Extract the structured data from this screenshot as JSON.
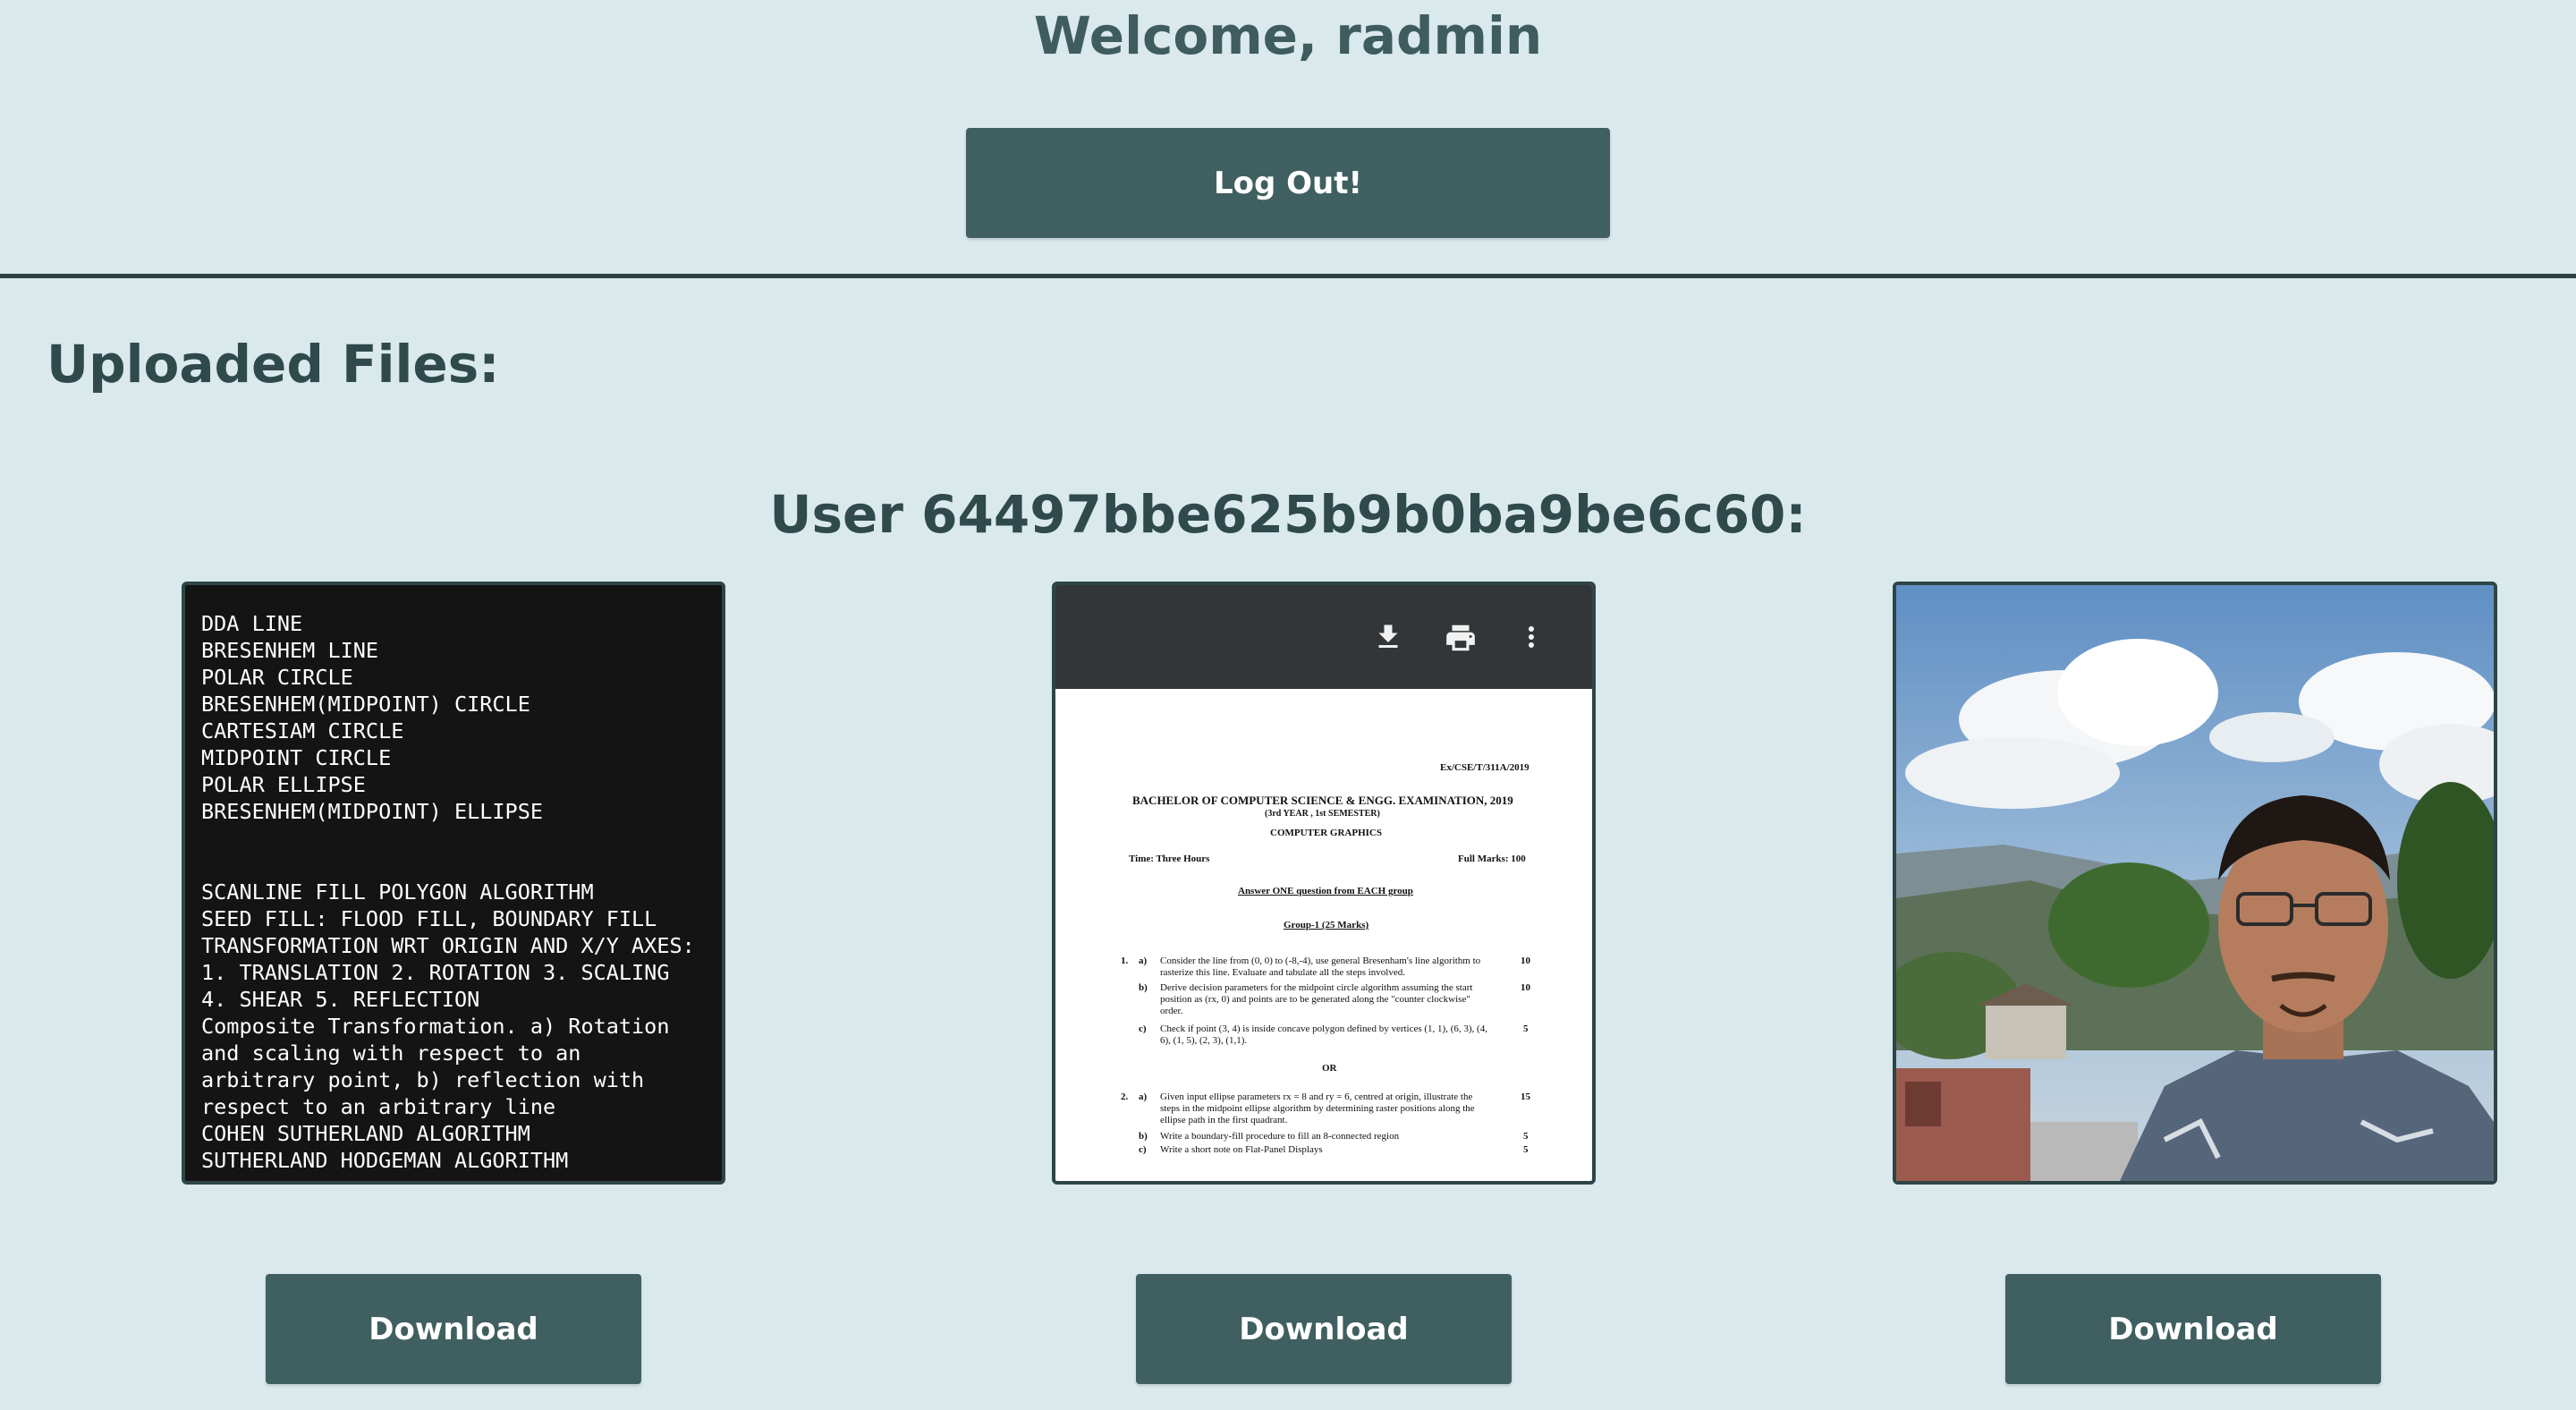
{
  "header": {
    "welcome": "Welcome, radmin",
    "logout_label": "Log Out!"
  },
  "section": {
    "uploaded_title": "Uploaded Files:",
    "user_title": "User 64497bbe625b9b0ba9be6c60:"
  },
  "files": [
    {
      "type": "text",
      "content": "DDA LINE\nBRESENHEM LINE\nPOLAR CIRCLE\nBRESENHEM(MIDPOINT) CIRCLE\nCARTESIAM CIRCLE\nMIDPOINT CIRCLE\nPOLAR ELLIPSE\nBRESENHEM(MIDPOINT) ELLIPSE\n\n\nSCANLINE FILL POLYGON ALGORITHM\nSEED FILL: FLOOD FILL, BOUNDARY FILL\nTRANSFORMATION WRT ORIGIN AND X/Y AXES: 1. TRANSLATION 2. ROTATION 3. SCALING 4. SHEAR 5. REFLECTION\nComposite Transformation. a) Rotation and scaling with respect to an arbitrary point, b) reflection with respect to an arbitrary line\nCOHEN SUTHERLAND ALGORITHM\nSUTHERLAND HODGEMAN ALGORITHM",
      "download_label": "Download"
    },
    {
      "type": "pdf",
      "toolbar_icons": [
        "download-icon",
        "print-icon",
        "more-vert-icon"
      ],
      "page": {
        "code": "Ex/CSE/T/311A/2019",
        "title": "BACHELOR OF COMPUTER SCIENCE & ENGG. EXAMINATION, 2019",
        "year": "(3rd YEAR , 1st SEMESTER)",
        "subject": "COMPUTER GRAPHICS",
        "time": "Time: Three Hours",
        "marks": "Full Marks: 100",
        "instruction": "Answer ONE question from EACH group",
        "group": "Group-1 (25 Marks)",
        "q1": "1.",
        "q1a_label": "a)",
        "q1a_l1": "Consider the line from (0, 0) to (-8,-4), use general Bresenham's line algorithm to",
        "q1a_l2": "rasterize this line. Evaluate and tabulate all the steps involved.",
        "q1a_marks": "10",
        "q1b_label": "b)",
        "q1b_l1": "Derive decision parameters for the midpoint circle algorithm assuming the start",
        "q1b_l2": "position as (rx, 0) and points are to be generated along the \"counter clockwise\"",
        "q1b_l3": "order.",
        "q1b_marks": "10",
        "q1c_label": "c)",
        "q1c_l1": "Check if point (3, 4) is inside concave polygon defined by vertices (1, 1), (6, 3), (4,",
        "q1c_l2": "6), (1, 5), (2, 3), (1,1).",
        "q1c_marks": "5",
        "or": "OR",
        "q2": "2.",
        "q2a_label": "a)",
        "q2a_l1": "Given input ellipse parameters rx = 8 and ry = 6, centred at origin, illustrate the",
        "q2a_l2": "steps in the midpoint ellipse algorithm by determining raster positions along the",
        "q2a_l3": "ellipse path in the first quadrant.",
        "q2a_marks": "15",
        "q2b_label": "b)",
        "q2b_l1": "Write a boundary-fill procedure to fill an 8-connected region",
        "q2b_marks": "5",
        "q2c_label": "c)",
        "q2c_l1": "Write a short note on Flat-Panel Displays",
        "q2c_marks": "5"
      },
      "download_label": "Download"
    },
    {
      "type": "image",
      "download_label": "Download"
    }
  ],
  "colors": {
    "background": "#dae9ec",
    "button": "#405f60",
    "heading": "#304a4c"
  }
}
